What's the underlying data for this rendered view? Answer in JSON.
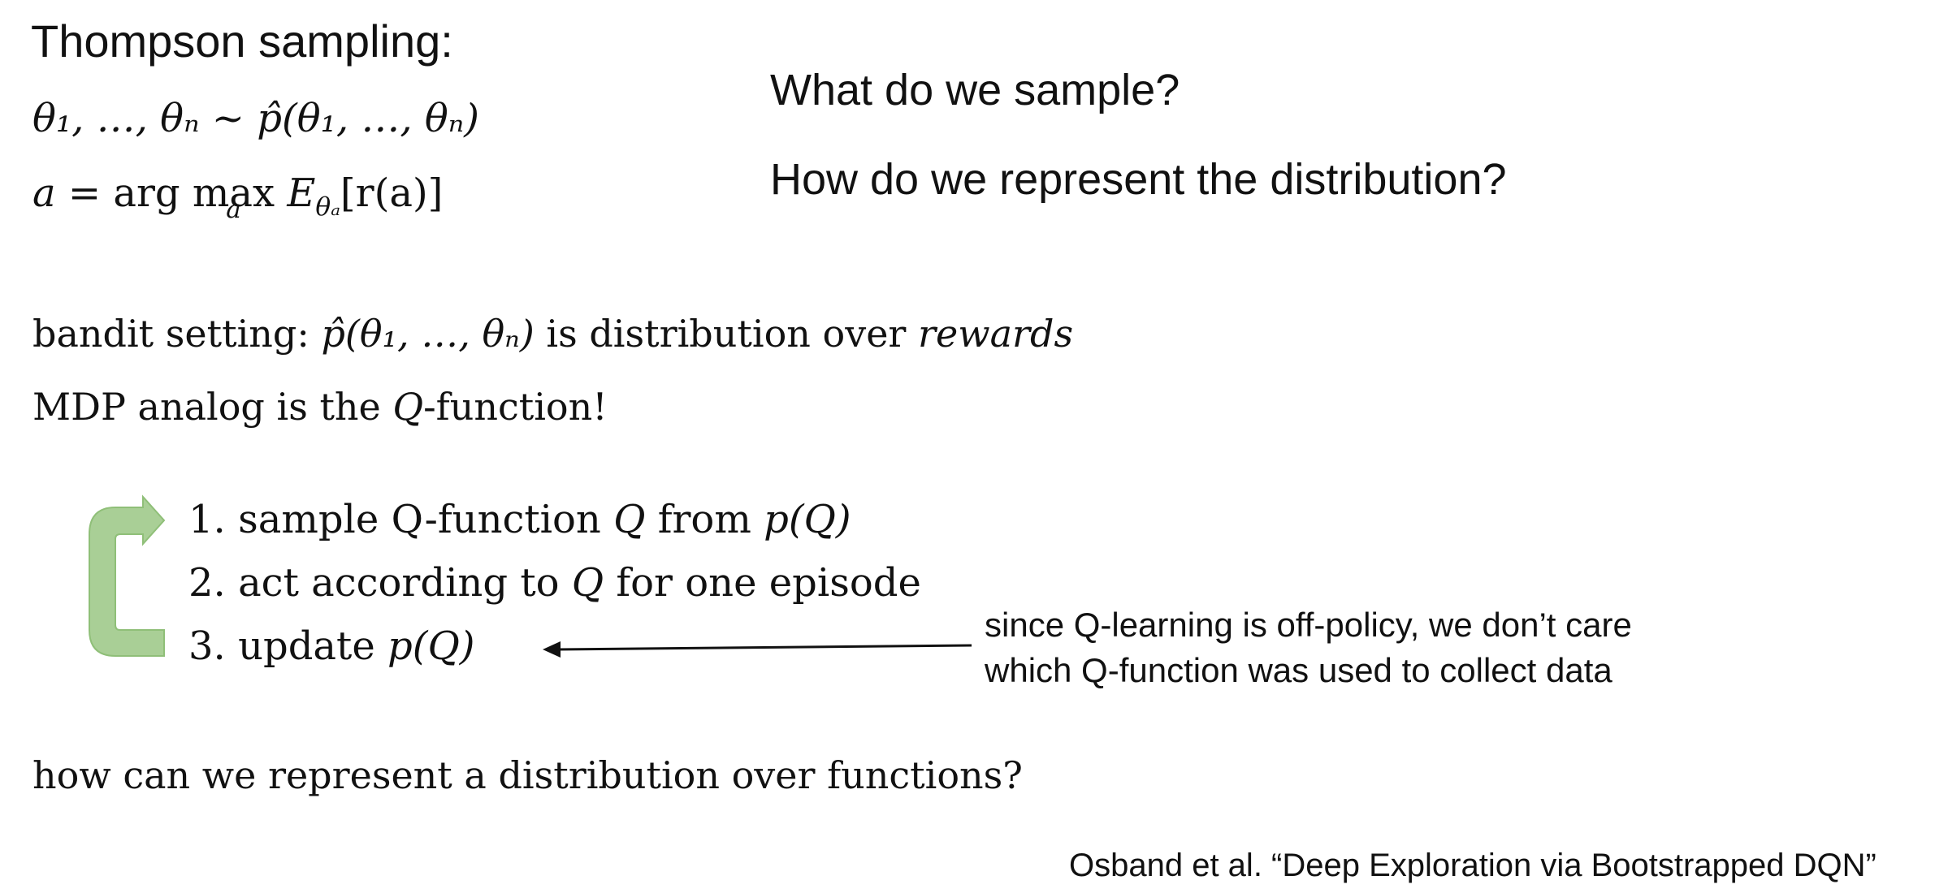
{
  "slide": {
    "title": "Thompson sampling:",
    "questions": [
      "What do we sample?",
      "How do we represent the distribution?"
    ],
    "eq1": {
      "lhs": "θ₁, …, θₙ",
      "sim": " ~ ",
      "rhs": "p̂(θ₁, …, θₙ)"
    },
    "eq2": {
      "lhs": "a",
      "eq": " = arg ",
      "max": "max",
      "under": "a",
      "expect": "E",
      "sub": "θₐ",
      "bracket": "[r(a)]"
    },
    "bandit": {
      "prefix": "bandit setting: ",
      "math": "p̂(θ₁, …, θₙ)",
      "middle": " is distribution over ",
      "emph": "rewards"
    },
    "mdp": {
      "prefix": "MDP analog is the ",
      "math": "Q",
      "suffix": "-function!"
    },
    "steps": [
      {
        "num": "1.",
        "pre": "sample Q-function ",
        "m1": "Q",
        "mid": " from ",
        "m2": "p(Q)",
        "post": ""
      },
      {
        "num": "2.",
        "pre": "act according to ",
        "m1": "Q",
        "mid": " for one episode",
        "m2": "",
        "post": ""
      },
      {
        "num": "3.",
        "pre": "update ",
        "m1": "p(Q)",
        "mid": "",
        "m2": "",
        "post": ""
      }
    ],
    "note_lines": [
      "since Q-learning is off-policy, we don’t care",
      "which Q-function was used to collect data"
    ],
    "question_bottom": "how can we represent a distribution over functions?",
    "citation": "Osband et al. “Deep Exploration via Bootstrapped DQN”"
  },
  "colors": {
    "text": "#111111",
    "loop_arrow": "#a9cf96",
    "loop_arrow_edge": "#8fbf78",
    "pointer_arrow": "#111111"
  },
  "icons": {
    "loop_arrow": "loop-arrow-icon",
    "pointer_arrow": "left-arrow-icon"
  }
}
